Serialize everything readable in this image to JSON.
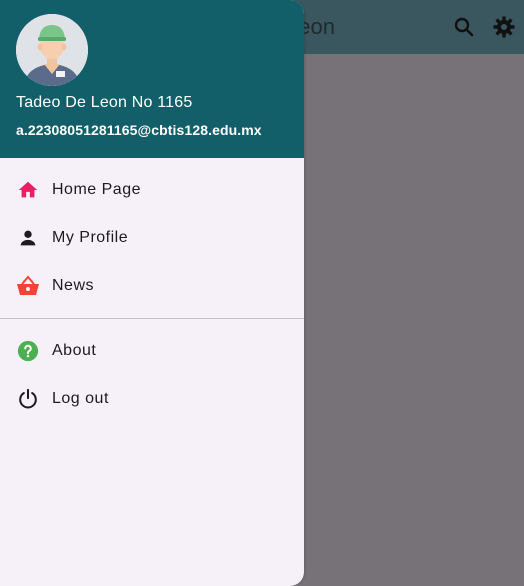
{
  "appbar": {
    "title": "eon",
    "search_icon": "search-icon",
    "settings_icon": "gear-icon"
  },
  "drawer": {
    "header": {
      "name": "Tadeo De Leon No 1165",
      "email": "a.22308051281165@cbtis128.edu.mx",
      "avatar_icon": "worker-avatar"
    },
    "items": [
      {
        "label": "Home Page",
        "icon": "home-icon",
        "color": "#e91e63"
      },
      {
        "label": "My Profile",
        "icon": "person-icon",
        "color": "#1d1b20"
      },
      {
        "label": "News",
        "icon": "basket-icon",
        "color": "#f44336"
      }
    ],
    "secondary_items": [
      {
        "label": "About",
        "icon": "help-icon",
        "color": "#4caf50"
      },
      {
        "label": "Log out",
        "icon": "power-icon",
        "color": "#1d1b20"
      }
    ]
  },
  "colors": {
    "header_bg": "#125f6a",
    "drawer_bg": "#f6f1f8",
    "appbar_bg": "#3a5760",
    "scrim": "#777277"
  }
}
